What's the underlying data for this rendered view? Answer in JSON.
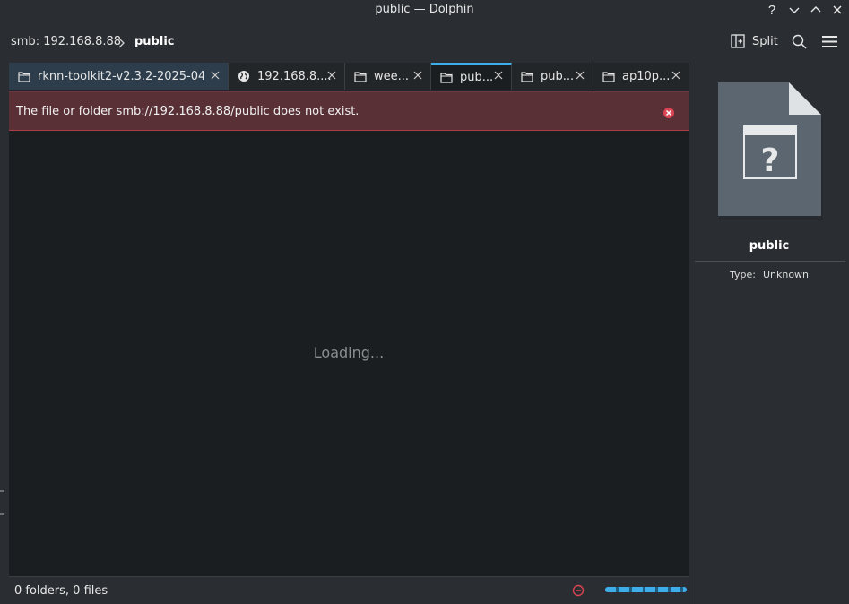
{
  "window": {
    "title": "public — Dolphin",
    "controls": [
      "help-icon",
      "minimize-icon",
      "maximize-icon",
      "close-icon"
    ]
  },
  "toolbar": {
    "breadcrumb": {
      "host": "smb: 192.168.8.88",
      "current": "public"
    },
    "split_label": "Split",
    "icons": [
      "split-icon",
      "search-icon",
      "menu-icon"
    ]
  },
  "tabs": [
    {
      "label": "rknn-toolkit2-v2.3.2-2025-04-...",
      "icon": "folder-icon",
      "active": false
    },
    {
      "label": "192.168.8....",
      "icon": "globe-icon",
      "active": false
    },
    {
      "label": "wee...",
      "icon": "folder-icon",
      "active": false
    },
    {
      "label": "pub...",
      "icon": "folder-icon",
      "active": true
    },
    {
      "label": "pub...",
      "icon": "folder-icon",
      "active": false
    },
    {
      "label": "ap10p...",
      "icon": "folder-icon",
      "active": false
    }
  ],
  "error": {
    "message": "The file or folder smb://192.168.8.88/public does not exist."
  },
  "view": {
    "loading_text": "Loading..."
  },
  "statusbar": {
    "summary": "0 folders, 0 files"
  },
  "info_panel": {
    "name": "public",
    "type_label": "Type:",
    "type_value": "Unknown",
    "preview_icon": "unknown-file-icon"
  },
  "colors": {
    "accent": "#3daee9",
    "error_bg": "#583036",
    "view_bg": "#1b1e20",
    "chrome_bg": "#2a2e32"
  }
}
